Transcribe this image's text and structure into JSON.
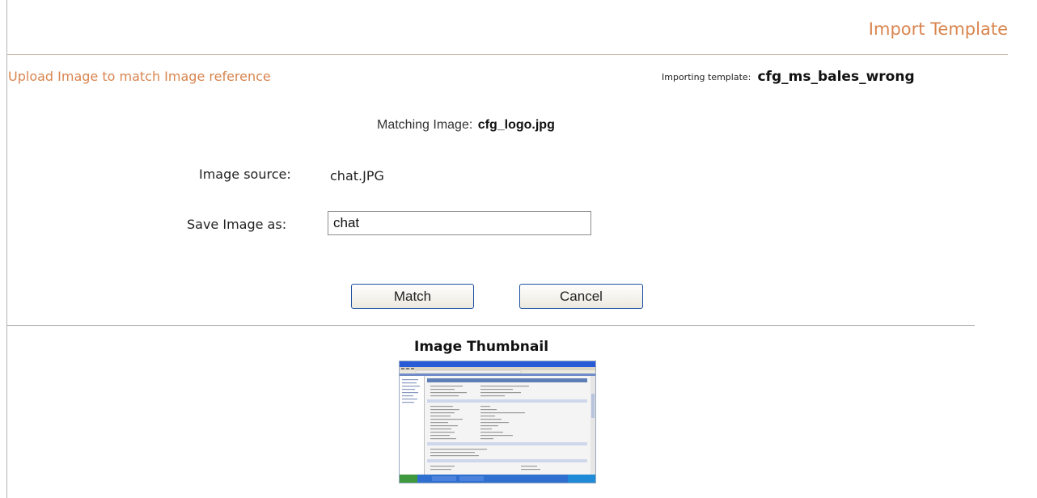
{
  "header": {
    "title": "Import Template"
  },
  "upload": {
    "heading": "Upload Image to match Image reference",
    "importing_label": "Importing template:",
    "importing_value": "cfg_ms_bales_wrong"
  },
  "form": {
    "matching_label": "Matching Image:",
    "matching_value": "cfg_logo.jpg",
    "source_label": "Image source:",
    "source_value": "chat.JPG",
    "save_as_label": "Save Image as:",
    "save_as_value": "chat"
  },
  "buttons": {
    "match_label": "Match",
    "cancel_label": "Cancel"
  },
  "thumbnail": {
    "title": "Image Thumbnail"
  },
  "colors": {
    "accent": "#d9854f",
    "button_border": "#1c4fa0",
    "thumbnail_titlebar": "#2a5bd7",
    "thumbnail_taskbar": "#2f6fd0"
  }
}
